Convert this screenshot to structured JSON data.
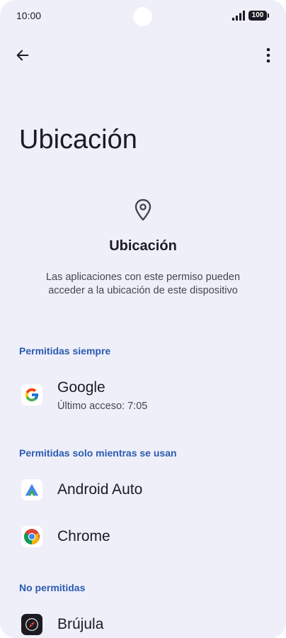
{
  "status_bar": {
    "time": "10:00",
    "battery": "100"
  },
  "page": {
    "title": "Ubicación"
  },
  "header": {
    "title": "Ubicación",
    "description": "Las aplicaciones con este permiso pueden acceder a la ubicación de este dispositivo"
  },
  "sections": [
    {
      "label": "Permitidas siempre"
    },
    {
      "label": "Permitidas solo mientras se usan"
    },
    {
      "label": "No permitidas"
    }
  ],
  "apps": [
    {
      "name": "Google",
      "subtitle": "Último acceso: 7:05",
      "icon": "google-icon"
    },
    {
      "name": "Android Auto",
      "icon": "android-auto-icon"
    },
    {
      "name": "Chrome",
      "icon": "chrome-icon"
    },
    {
      "name": "Brújula",
      "icon": "compass-icon"
    }
  ],
  "colors": {
    "background": "#efeffa",
    "accent": "#2a5bb0",
    "text_primary": "#1b1b21",
    "text_secondary": "#45464f"
  }
}
